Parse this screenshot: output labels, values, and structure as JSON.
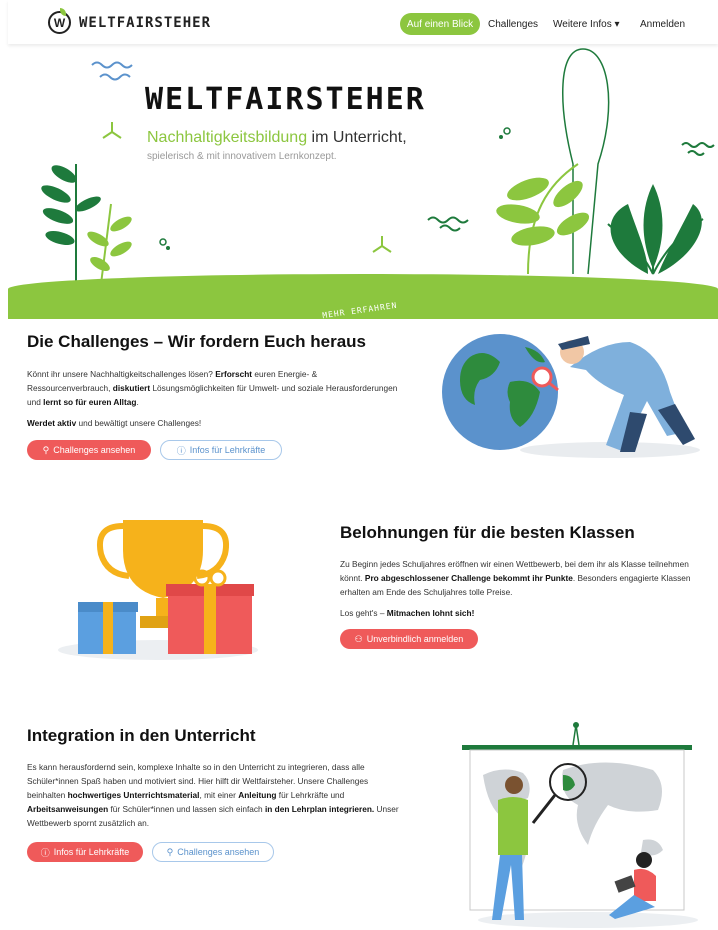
{
  "nav": {
    "logo_letter": "W",
    "logo_text": "WELTFAIRSTEHER",
    "cta": "Auf einen Blick",
    "items": [
      "Challenges",
      "Weitere Infos ▾",
      "Anmelden"
    ]
  },
  "hero": {
    "title": "WELTFAIRSTEHER",
    "subtitle_green": "Nachhaltigkeitsbildung",
    "subtitle_rest": " im Unterricht,",
    "small": "spielerisch & mit innovativem Lernkonzept.",
    "more": "MEHR ERFAHREN"
  },
  "challenges": {
    "heading": "Die Challenges – Wir fordern Euch heraus",
    "p1_a": "Könnt ihr unsere Nachhaltigkeitschallenges lösen? ",
    "p1_b": "Erforscht",
    "p1_c": " euren Energie- & Ressourcenverbrauch, ",
    "p1_d": "diskutiert",
    "p1_e": " Lösungsmöglichkeiten für Umwelt- und soziale Herausforderungen und ",
    "p1_f": "lernt so für euren Alltag",
    "p1_g": ".",
    "p2_a": "Werdet aktiv",
    "p2_b": " und bewältigt unsere Challenges!",
    "btn_primary": "Challenges ansehen",
    "btn_secondary": "Infos für Lehrkräfte"
  },
  "rewards": {
    "heading": "Belohnungen für die besten Klassen",
    "p1_a": "Zu Beginn jedes Schuljahres eröffnen wir einen Wettbewerb, bei dem ihr als Klasse teilnehmen könnt. ",
    "p1_b": "Pro abgeschlossener Challenge bekommt ihr Punkte",
    "p1_c": ". Besonders engagierte Klassen erhalten am Ende des Schuljahres tolle Preise.",
    "p2_a": "Los geht's – ",
    "p2_b": "Mitmachen lohnt sich!",
    "btn_primary": "Unverbindlich anmelden"
  },
  "integration": {
    "heading": "Integration in den Unterricht",
    "p1_a": "Es kann herausfordernd sein, komplexe Inhalte so in den Unterricht zu integrieren, dass alle Schüler*innen Spaß haben und motiviert sind. Hier hilft dir Weltfairsteher. Unsere Challenges beinhalten ",
    "p1_b": "hochwertiges Unterrichtsmaterial",
    "p1_c": ", mit einer ",
    "p1_d": "Anleitung",
    "p1_e": " für Lehrkräfte und ",
    "p1_f": "Arbeitsanweisungen",
    "p1_g": " für Schüler*innen und lassen sich einfach ",
    "p1_h": "in den Lehrplan integrieren.",
    "p1_i": " Unser Wettbewerb spornt zusätzlich an.",
    "btn_primary": "Infos für Lehrkräfte",
    "btn_secondary": "Challenges ansehen"
  },
  "colors": {
    "green": "#8cc63f",
    "dark_green": "#1e7a3c",
    "red": "#ef5a5a",
    "blue": "#5b92cc"
  }
}
